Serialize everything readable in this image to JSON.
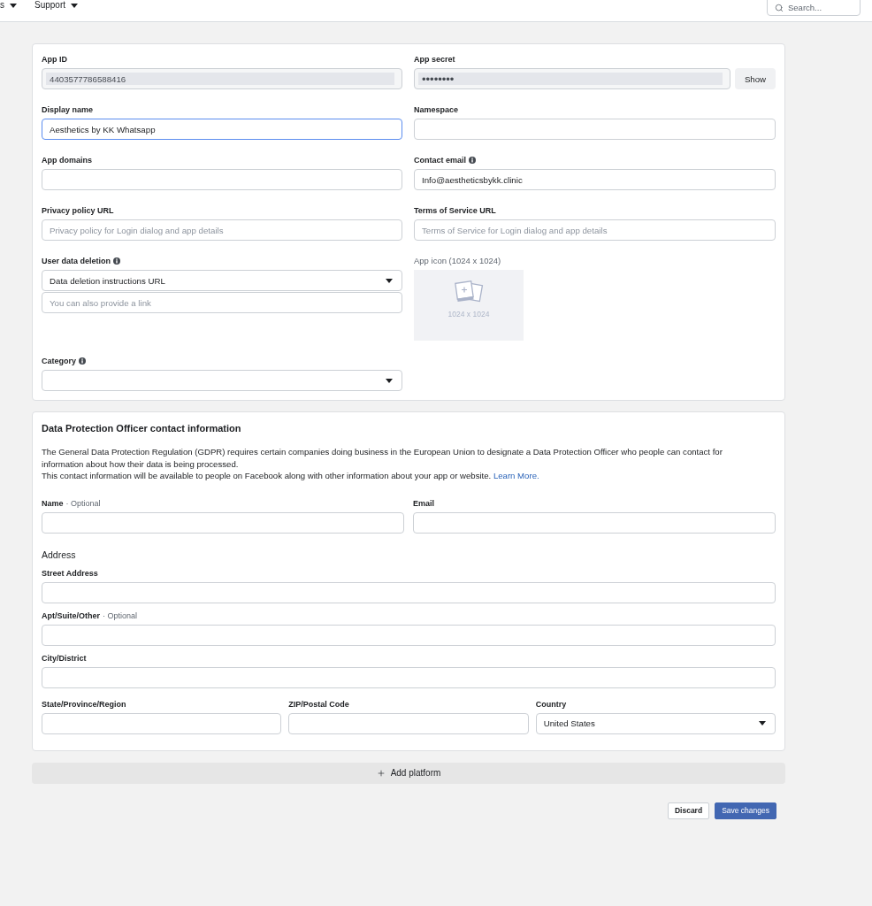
{
  "top_nav": {
    "items": [
      {
        "label": "s",
        "dropdown": true
      },
      {
        "label": "Support",
        "dropdown": true
      }
    ],
    "search": {
      "placeholder": "Search..."
    }
  },
  "basic_settings": {
    "left": [
      {
        "kind": "readonly",
        "label": "App ID",
        "info": false,
        "focused": false,
        "value": "4403577786588416"
      },
      {
        "kind": "text",
        "label": "Display name",
        "info": false,
        "focused": true,
        "value": "Aesthetics by KK Whatsapp"
      },
      {
        "kind": "text",
        "label": "App domains",
        "info": false,
        "focused": false
      },
      {
        "kind": "text",
        "label": "Privacy policy URL",
        "info": false,
        "focused": false,
        "placeholder": "Privacy policy for Login dialog and app details"
      },
      {
        "kind": "select_link",
        "label": "User data deletion",
        "info": true,
        "focused": false,
        "value": "Data deletion instructions URL",
        "link_placeholder": "You can also provide a link"
      },
      {
        "kind": "select",
        "label": "Category",
        "info": true,
        "focused": false
      }
    ],
    "right": [
      {
        "kind": "secret",
        "label": "App secret",
        "info": false,
        "focused": false,
        "value": "••••••••",
        "button": "Show"
      },
      {
        "kind": "text",
        "label": "Namespace",
        "info": false,
        "focused": false
      },
      {
        "kind": "text",
        "label": "Contact email",
        "info": true,
        "focused": false,
        "value": "Info@aestheticsbykk.clinic"
      },
      {
        "kind": "text",
        "label": "Terms of Service URL",
        "info": false,
        "focused": false,
        "placeholder": "Terms of Service for Login dialog and app details"
      },
      {
        "kind": "image",
        "label": "App icon (1024 x 1024)",
        "info": false,
        "focused": false,
        "caption": "1024 x 1024"
      }
    ]
  },
  "dpo": {
    "title": "Data Protection Officer contact information",
    "paragraphs": [
      {
        "text": "The General Data Protection Regulation (GDPR) requires certain companies doing business in the European Union to designate a Data Protection Officer who people can contact for information about how their data is being processed."
      },
      {
        "text": "This contact information will be available to people on Facebook along with other information about your app or website.",
        "link": "Learn More."
      }
    ],
    "contact_fields": [
      {
        "kind": "text",
        "label": "Name",
        "optional": "· Optional"
      },
      {
        "kind": "text",
        "label": "Email"
      }
    ],
    "address": {
      "heading": "Address",
      "rows": [
        {
          "fields": [
            {
              "kind": "text",
              "label": "Street Address"
            }
          ]
        },
        {
          "fields": [
            {
              "kind": "text",
              "label": "Apt/Suite/Other",
              "optional": "· Optional"
            }
          ]
        },
        {
          "fields": [
            {
              "kind": "text",
              "label": "City/District"
            }
          ]
        },
        {
          "fields": [
            {
              "kind": "text",
              "label": "State/Province/Region"
            },
            {
              "kind": "text",
              "label": "ZIP/Postal Code"
            },
            {
              "kind": "select",
              "label": "Country",
              "value": "United States"
            }
          ]
        }
      ]
    }
  },
  "add_platform": {
    "label": "Add platform"
  },
  "actions": [
    {
      "kind": "secondary",
      "label": "Discard"
    },
    {
      "kind": "primary",
      "label": "Save changes"
    }
  ]
}
